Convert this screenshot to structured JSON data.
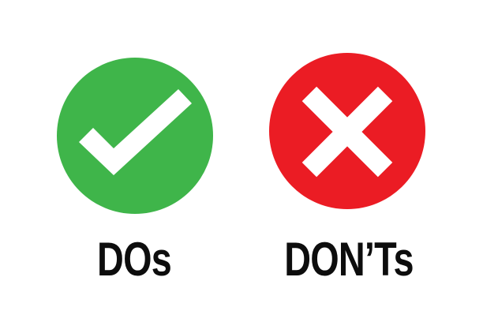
{
  "do": {
    "label": "DOs",
    "color": "#3fb54a",
    "icon": "check-icon"
  },
  "dont": {
    "label": "DON’Ts",
    "color": "#eb1c24",
    "icon": "cross-icon"
  }
}
